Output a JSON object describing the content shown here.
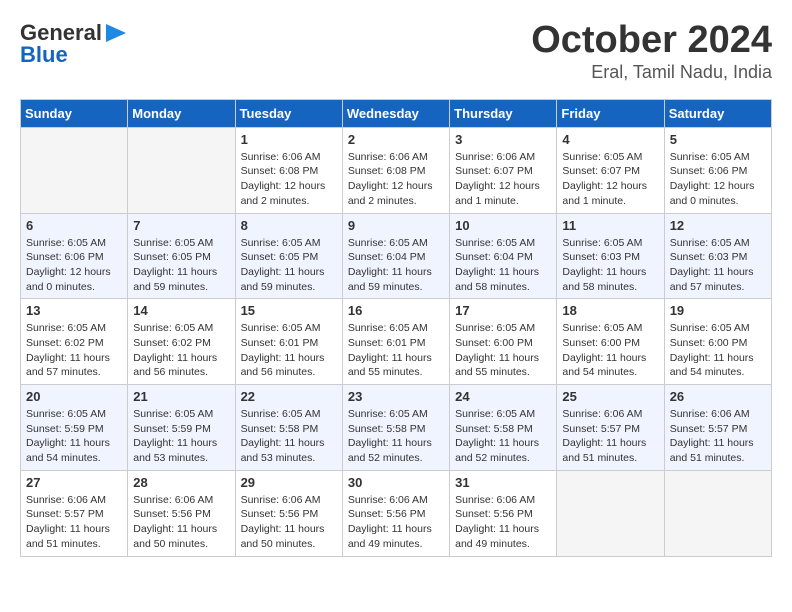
{
  "header": {
    "logo_general": "General",
    "logo_blue": "Blue",
    "title": "October 2024",
    "subtitle": "Eral, Tamil Nadu, India"
  },
  "calendar": {
    "days_of_week": [
      "Sunday",
      "Monday",
      "Tuesday",
      "Wednesday",
      "Thursday",
      "Friday",
      "Saturday"
    ],
    "weeks": [
      [
        {
          "day": "",
          "info": ""
        },
        {
          "day": "",
          "info": ""
        },
        {
          "day": "1",
          "info": "Sunrise: 6:06 AM\nSunset: 6:08 PM\nDaylight: 12 hours\nand 2 minutes."
        },
        {
          "day": "2",
          "info": "Sunrise: 6:06 AM\nSunset: 6:08 PM\nDaylight: 12 hours\nand 2 minutes."
        },
        {
          "day": "3",
          "info": "Sunrise: 6:06 AM\nSunset: 6:07 PM\nDaylight: 12 hours\nand 1 minute."
        },
        {
          "day": "4",
          "info": "Sunrise: 6:05 AM\nSunset: 6:07 PM\nDaylight: 12 hours\nand 1 minute."
        },
        {
          "day": "5",
          "info": "Sunrise: 6:05 AM\nSunset: 6:06 PM\nDaylight: 12 hours\nand 0 minutes."
        }
      ],
      [
        {
          "day": "6",
          "info": "Sunrise: 6:05 AM\nSunset: 6:06 PM\nDaylight: 12 hours\nand 0 minutes."
        },
        {
          "day": "7",
          "info": "Sunrise: 6:05 AM\nSunset: 6:05 PM\nDaylight: 11 hours\nand 59 minutes."
        },
        {
          "day": "8",
          "info": "Sunrise: 6:05 AM\nSunset: 6:05 PM\nDaylight: 11 hours\nand 59 minutes."
        },
        {
          "day": "9",
          "info": "Sunrise: 6:05 AM\nSunset: 6:04 PM\nDaylight: 11 hours\nand 59 minutes."
        },
        {
          "day": "10",
          "info": "Sunrise: 6:05 AM\nSunset: 6:04 PM\nDaylight: 11 hours\nand 58 minutes."
        },
        {
          "day": "11",
          "info": "Sunrise: 6:05 AM\nSunset: 6:03 PM\nDaylight: 11 hours\nand 58 minutes."
        },
        {
          "day": "12",
          "info": "Sunrise: 6:05 AM\nSunset: 6:03 PM\nDaylight: 11 hours\nand 57 minutes."
        }
      ],
      [
        {
          "day": "13",
          "info": "Sunrise: 6:05 AM\nSunset: 6:02 PM\nDaylight: 11 hours\nand 57 minutes."
        },
        {
          "day": "14",
          "info": "Sunrise: 6:05 AM\nSunset: 6:02 PM\nDaylight: 11 hours\nand 56 minutes."
        },
        {
          "day": "15",
          "info": "Sunrise: 6:05 AM\nSunset: 6:01 PM\nDaylight: 11 hours\nand 56 minutes."
        },
        {
          "day": "16",
          "info": "Sunrise: 6:05 AM\nSunset: 6:01 PM\nDaylight: 11 hours\nand 55 minutes."
        },
        {
          "day": "17",
          "info": "Sunrise: 6:05 AM\nSunset: 6:00 PM\nDaylight: 11 hours\nand 55 minutes."
        },
        {
          "day": "18",
          "info": "Sunrise: 6:05 AM\nSunset: 6:00 PM\nDaylight: 11 hours\nand 54 minutes."
        },
        {
          "day": "19",
          "info": "Sunrise: 6:05 AM\nSunset: 6:00 PM\nDaylight: 11 hours\nand 54 minutes."
        }
      ],
      [
        {
          "day": "20",
          "info": "Sunrise: 6:05 AM\nSunset: 5:59 PM\nDaylight: 11 hours\nand 54 minutes."
        },
        {
          "day": "21",
          "info": "Sunrise: 6:05 AM\nSunset: 5:59 PM\nDaylight: 11 hours\nand 53 minutes."
        },
        {
          "day": "22",
          "info": "Sunrise: 6:05 AM\nSunset: 5:58 PM\nDaylight: 11 hours\nand 53 minutes."
        },
        {
          "day": "23",
          "info": "Sunrise: 6:05 AM\nSunset: 5:58 PM\nDaylight: 11 hours\nand 52 minutes."
        },
        {
          "day": "24",
          "info": "Sunrise: 6:05 AM\nSunset: 5:58 PM\nDaylight: 11 hours\nand 52 minutes."
        },
        {
          "day": "25",
          "info": "Sunrise: 6:06 AM\nSunset: 5:57 PM\nDaylight: 11 hours\nand 51 minutes."
        },
        {
          "day": "26",
          "info": "Sunrise: 6:06 AM\nSunset: 5:57 PM\nDaylight: 11 hours\nand 51 minutes."
        }
      ],
      [
        {
          "day": "27",
          "info": "Sunrise: 6:06 AM\nSunset: 5:57 PM\nDaylight: 11 hours\nand 51 minutes."
        },
        {
          "day": "28",
          "info": "Sunrise: 6:06 AM\nSunset: 5:56 PM\nDaylight: 11 hours\nand 50 minutes."
        },
        {
          "day": "29",
          "info": "Sunrise: 6:06 AM\nSunset: 5:56 PM\nDaylight: 11 hours\nand 50 minutes."
        },
        {
          "day": "30",
          "info": "Sunrise: 6:06 AM\nSunset: 5:56 PM\nDaylight: 11 hours\nand 49 minutes."
        },
        {
          "day": "31",
          "info": "Sunrise: 6:06 AM\nSunset: 5:56 PM\nDaylight: 11 hours\nand 49 minutes."
        },
        {
          "day": "",
          "info": ""
        },
        {
          "day": "",
          "info": ""
        }
      ]
    ]
  }
}
